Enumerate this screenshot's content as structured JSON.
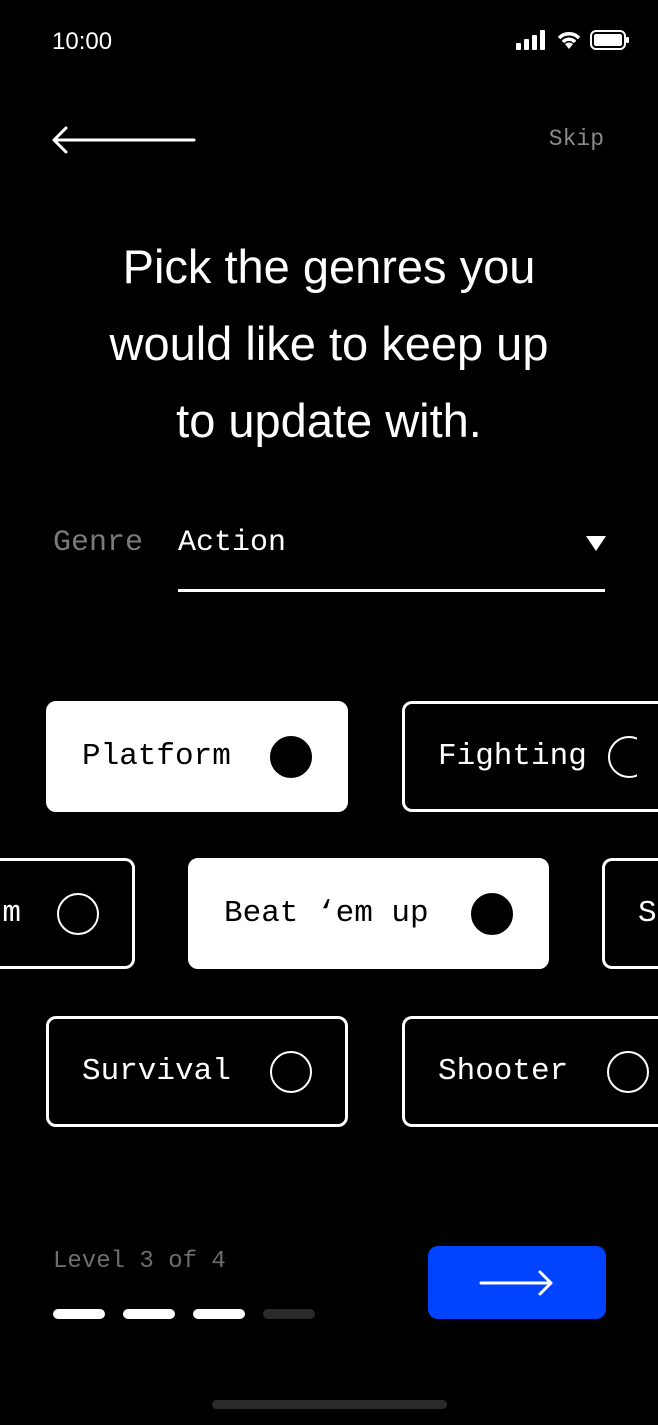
{
  "status_bar": {
    "time": "10:00"
  },
  "header": {
    "back_icon": "arrow-left-icon",
    "skip_label": "Skip"
  },
  "title": [
    "Pick the genres you",
    "would like to keep up",
    "to update with."
  ],
  "genre_select": {
    "label": "Genre",
    "value": "Action"
  },
  "chips": [
    {
      "label": "Platform",
      "selected": true
    },
    {
      "label": "Fighting",
      "selected": false
    },
    {
      "label": "m",
      "selected": false
    },
    {
      "label": "Beat ‘em up",
      "selected": true
    },
    {
      "label": "S",
      "selected": false
    },
    {
      "label": "Survival",
      "selected": false
    },
    {
      "label": "Shooter",
      "selected": false
    }
  ],
  "progress": {
    "label": "Level 3 of 4",
    "current": 3,
    "total": 4
  },
  "next_button": {
    "icon": "arrow-right-icon",
    "color": "#0044ff"
  }
}
